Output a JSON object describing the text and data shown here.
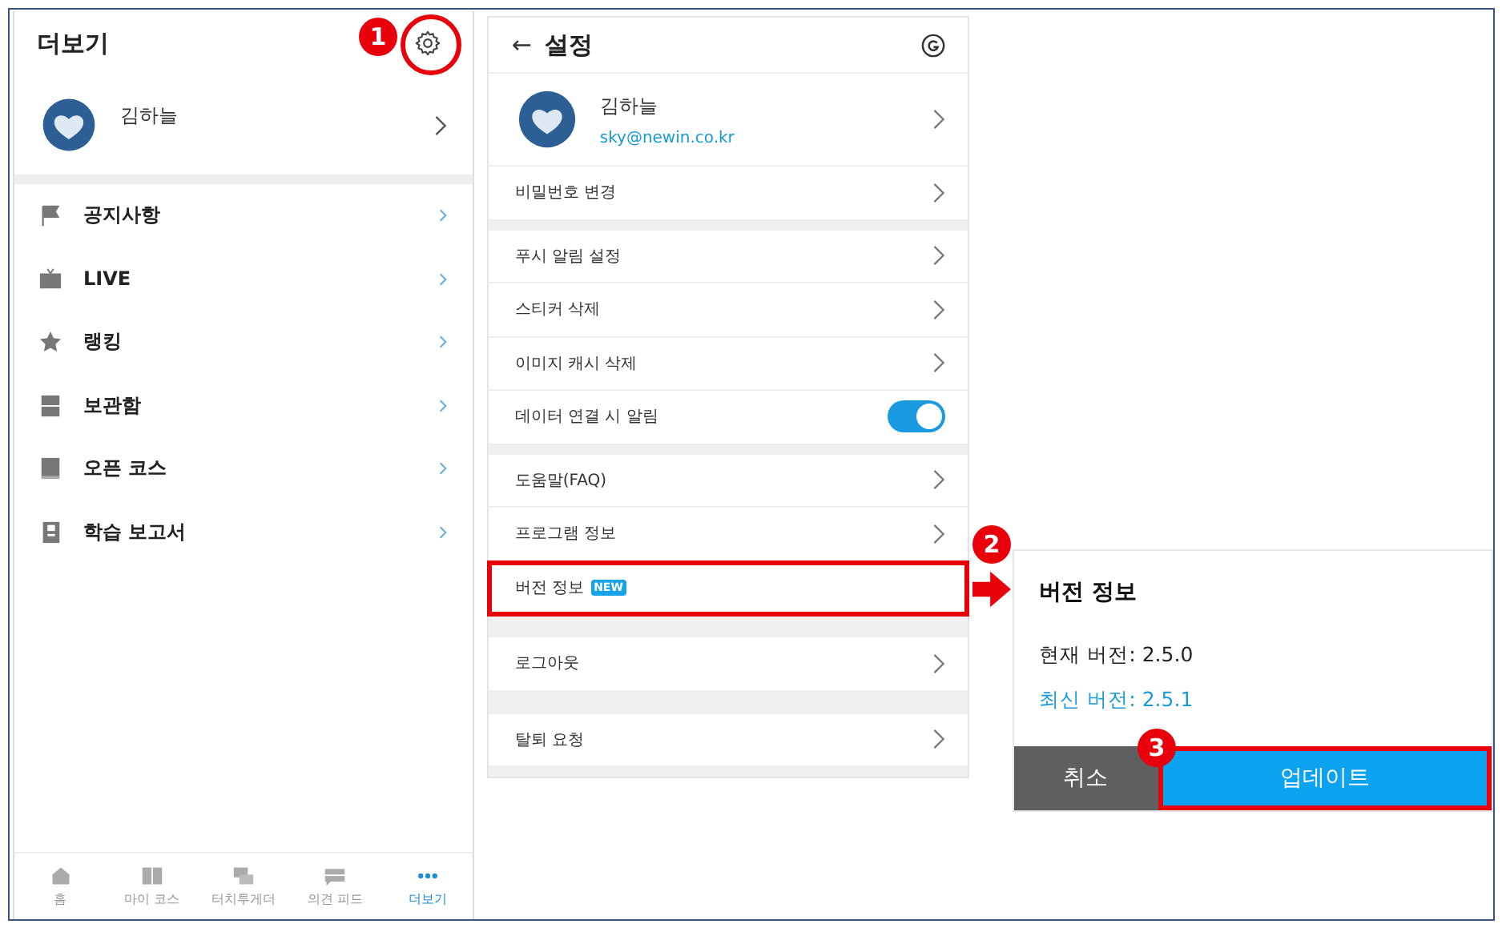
{
  "more_panel": {
    "title": "더보기",
    "profile": {
      "name": "김하늘"
    },
    "menu": [
      {
        "label": "공지사항"
      },
      {
        "label": "LIVE"
      },
      {
        "label": "랭킹"
      },
      {
        "label": "보관함"
      },
      {
        "label": "오픈 코스"
      },
      {
        "label": "학습 보고서"
      }
    ],
    "bottom_nav": [
      {
        "label": "홈",
        "selected": false
      },
      {
        "label": "마이 코스",
        "selected": false
      },
      {
        "label": "터치투게더",
        "selected": false
      },
      {
        "label": "의견 피드",
        "selected": false
      },
      {
        "label": "더보기",
        "selected": true
      }
    ]
  },
  "settings_panel": {
    "back": "←",
    "title": "설정",
    "profile": {
      "name": "김하늘",
      "email": "sky@newin.co.kr"
    },
    "sections": [
      [
        {
          "kind": "link",
          "label": "비밀번호 변경"
        }
      ],
      [
        {
          "kind": "link",
          "label": "푸시 알림 설정"
        },
        {
          "kind": "link",
          "label": "스티커 삭제"
        },
        {
          "kind": "link",
          "label": "이미지 캐시 삭제"
        },
        {
          "kind": "toggle",
          "label": "데이터 연결 시 알림",
          "on": true
        }
      ],
      [
        {
          "kind": "link",
          "label": "도움말(FAQ)"
        },
        {
          "kind": "link",
          "label": "프로그램 정보"
        },
        {
          "kind": "badge",
          "label": "버전 정보",
          "badge": "NEW",
          "highlighted": true
        }
      ],
      [
        {
          "kind": "link",
          "label": "로그아웃"
        }
      ],
      [
        {
          "kind": "link",
          "label": "탈퇴 요청"
        }
      ]
    ]
  },
  "version_dialog": {
    "title": "버전 정보",
    "current": "현재 버전: 2.5.0",
    "latest": "최신 버전: 2.5.1",
    "buttons": [
      {
        "kind": "cancel",
        "label": "취소",
        "highlighted": false
      },
      {
        "kind": "primary",
        "label": "업데이트",
        "highlighted": true
      }
    ]
  },
  "annotations": [
    {
      "label": "1"
    },
    {
      "label": "2"
    },
    {
      "label": "3"
    }
  ]
}
